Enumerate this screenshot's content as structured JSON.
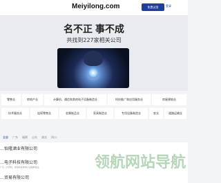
{
  "header": {
    "nav": [
      "",
      "",
      ""
    ],
    "logo": "Meiyilong.com",
    "primary_button": "免费试用",
    "secondary_button": "登录"
  },
  "hero": {
    "title": "名不正 事不成",
    "subtitle": "共找到227家相关公司"
  },
  "categories": [
    "零售业",
    "房地产业",
    "计算机、通信和其他电子设备制造业",
    "科技推广和应用服务业",
    "房屋建筑业",
    "技术服务业",
    "连续零售业",
    "金属制品业",
    "家具制造业",
    "专用设备制造业",
    "农业",
    "道路运输业"
  ],
  "tabs": [
    "全部",
    "广东",
    "福建",
    "山东",
    "湖北",
    "四川"
  ],
  "results": [
    {
      "name": "…怡隆酒业有限公司",
      "sub": ""
    },
    {
      "name": "…电子科技有限公司",
      "sub": "广东 | 计算机、通信和其他电子设备制造业"
    },
    {
      "name": "…贸易有限公司",
      "sub": ""
    }
  ],
  "watermark": "领航网站导航"
}
